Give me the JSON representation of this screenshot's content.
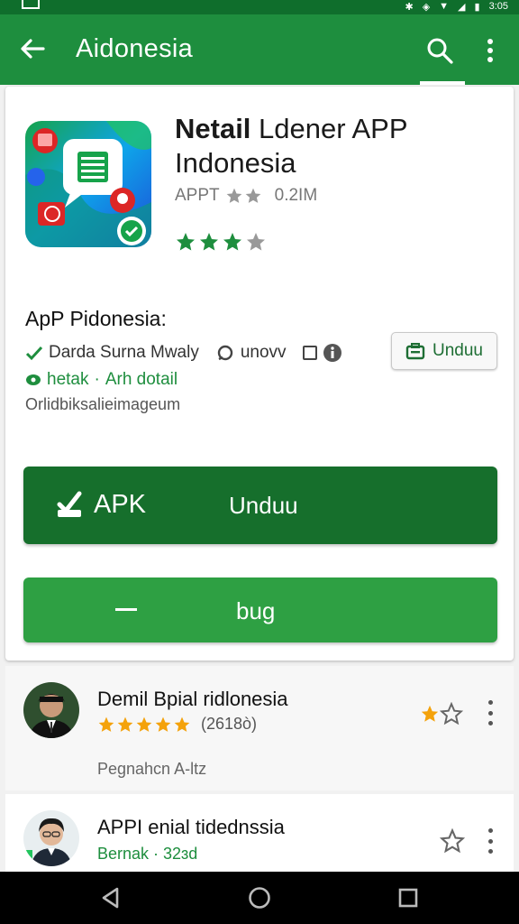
{
  "status_bar": {
    "time": "3:05"
  },
  "app_bar": {
    "title": "Aidonesia",
    "back_icon": "arrow-back-icon",
    "search_icon": "search-icon",
    "more_icon": "more-vert-icon"
  },
  "app": {
    "name_bold": "Netail",
    "name_rest": " Ldener APP",
    "name_line2": "Indonesia",
    "category": "APPT",
    "size": "0.2IM",
    "rating_stars": 3,
    "rating_total": 4
  },
  "details": {
    "title": "ApP Pidonesia:",
    "row1_text": "Darda Surna Mwaly",
    "row1_extra": "unovv",
    "row2_a": "hetak",
    "row2_b": "Arh dotail",
    "row3": "Orlidbiksalieimageum",
    "small_button": "Unduu"
  },
  "buttons": {
    "apk_label": "APK",
    "unduh_label": "Unduu",
    "bug_label": "bug"
  },
  "reviews": [
    {
      "name": "Demil Bpial ridlonesia",
      "stars": 5,
      "count": "(2618ò)",
      "meta": "Pegnahcn A-ltz",
      "fav_stars": 1
    },
    {
      "name": "APPI enial tidednssia",
      "meta": "Bernak · 32ɜd",
      "fav_stars": 0
    }
  ],
  "colors": {
    "primary": "#1e8e3e",
    "primary_dark": "#166f2c",
    "button_light": "#2ea043",
    "star_green": "#1e8e3e",
    "star_gold": "#f4a20b"
  }
}
